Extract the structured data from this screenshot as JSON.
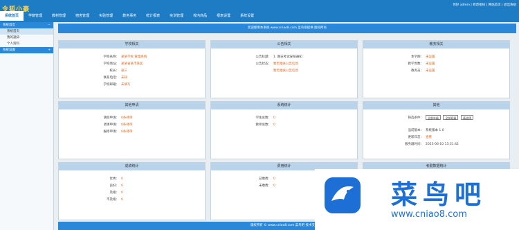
{
  "header": {
    "logo": "令狐小豪",
    "topright": "你好 admin | 修改密码 | 网站首页 | 退出系统",
    "nav": [
      "系统首页",
      "学籍管理",
      "教材管理",
      "宿舍管理",
      "实验管理",
      "教务事务",
      "统计报表",
      "实训管理",
      "校内商品",
      "报表设置",
      "系统设置"
    ]
  },
  "sidebar": {
    "section1": "系统首页",
    "items": [
      "系统首页",
      "我的通知",
      "个人资料"
    ],
    "section2": "系统设置"
  },
  "banner": "欢迎使用本系统 www.cniao8.com 菜鸟吧提供 版权所有",
  "panels": {
    "p1": {
      "title": "学校相关",
      "rows": [
        {
          "l": "学校名称：",
          "v": "某某学校 管理系统"
        },
        {
          "l": "学校地址：",
          "v": "某某省某市某区"
        },
        {
          "l": "校长：",
          "v": "张三"
        },
        {
          "l": "联系电话：",
          "v": "未知"
        },
        {
          "l": "学校邮箱：",
          "v": "未填写"
        }
      ]
    },
    "p2": {
      "title": "公告相关",
      "rows": [
        {
          "l": "公告标题：",
          "v": "1. 期末考试安排通知",
          "dark": true
        },
        {
          "l": "公告状态：",
          "v": "暂无相关公告信息"
        },
        {
          "l": "",
          "v": "暂无相关公告信息"
        }
      ]
    },
    "p3": {
      "title": "教务相关",
      "rows": [
        {
          "l": "本学期：",
          "v": "未设置"
        },
        {
          "l": "教学周数：",
          "v": "未设置"
        },
        {
          "l": "教务员：",
          "v": "未设置"
        }
      ]
    },
    "p4": {
      "title": "其他申请",
      "rows": [
        {
          "l": "请假申请：",
          "v": "0条待审"
        },
        {
          "l": "调课申请：",
          "v": "0条待审"
        },
        {
          "l": "报修申请：",
          "v": "0条待审"
        }
      ]
    },
    "p5": {
      "title": "系统统计",
      "rows": [
        {
          "l": "学生总数：",
          "v": "0"
        },
        {
          "l": "教师总数：",
          "v": "0"
        }
      ]
    },
    "p6": {
      "title": "其他",
      "selects": [
        "全部年级",
        "全部班级",
        "请选择"
      ],
      "rows": [
        {
          "l": "当前版本：",
          "v": "系统版本 1.0",
          "dark": true
        },
        {
          "l": "更新日志：",
          "v": "查看"
        },
        {
          "l": "服务器时间：",
          "v": "2023-06-10 13:31:42",
          "dark": true
        }
      ]
    },
    "p7": {
      "title": "成绩统计",
      "rows": [
        {
          "l": "优秀：",
          "v": "0"
        },
        {
          "l": "良好：",
          "v": "0"
        },
        {
          "l": "及格：",
          "v": "0"
        },
        {
          "l": "不及格：",
          "v": "0"
        }
      ]
    },
    "p8": {
      "title": "费用统计",
      "rows": [
        {
          "l": "已缴费：",
          "v": "0"
        },
        {
          "l": "未缴费：",
          "v": "0"
        }
      ]
    },
    "p9": {
      "title": "考勤数据统计",
      "rows": []
    }
  },
  "footer": "版权所有 © www.cniao8.com 菜鸟吧 技术支持 1.0",
  "watermark": {
    "text": "菜鸟吧",
    "url": "www.cniao8.com"
  },
  "colors": {
    "primary": "#1e7cc4",
    "panel_header": "#b9d3ea",
    "value": "#e0661a"
  }
}
